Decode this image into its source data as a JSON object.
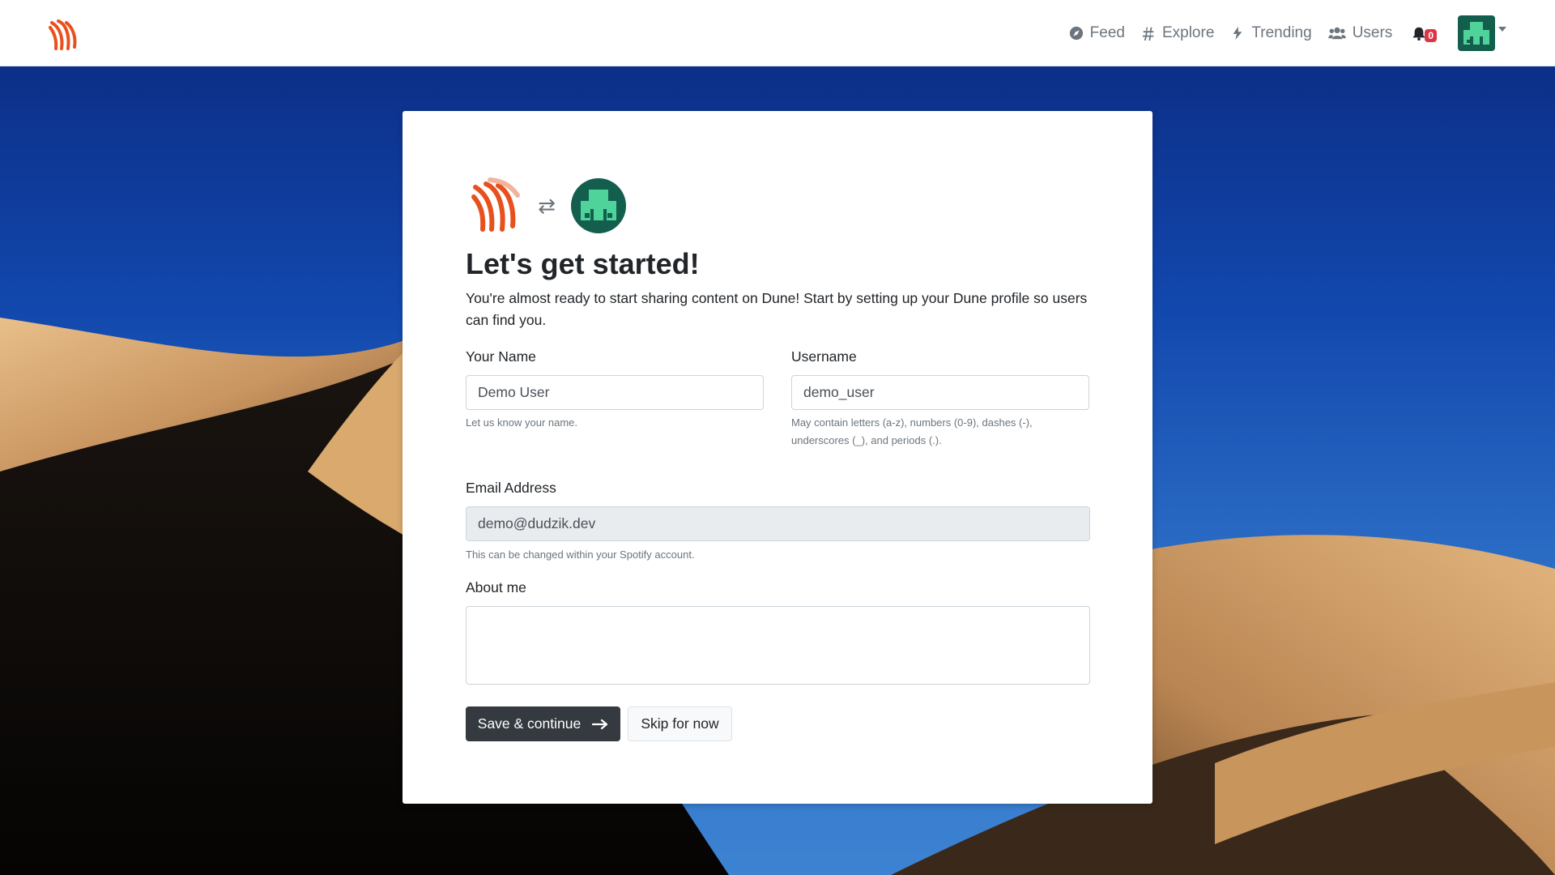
{
  "navbar": {
    "logo_icon": "dune-logo-icon",
    "links": [
      {
        "label": "Feed",
        "icon": "compass-icon"
      },
      {
        "label": "Explore",
        "icon": "hashtag-icon"
      },
      {
        "label": "Trending",
        "icon": "bolt-icon"
      },
      {
        "label": "Users",
        "icon": "users-icon"
      }
    ],
    "notifications_count": "0",
    "avatar_icon": "user-avatar-icon"
  },
  "card": {
    "swap_symbol": "⇄",
    "title": "Let's get started!",
    "lead": "You're almost ready to start sharing content on Dune! Start by setting up your Dune profile so users can find you.",
    "name": {
      "label": "Your Name",
      "value": "Demo User",
      "help": "Let us know your name."
    },
    "username": {
      "label": "Username",
      "value": "demo_user",
      "help": "May contain letters (a-z), numbers (0-9), dashes (-), underscores (_), and periods (.)."
    },
    "email": {
      "label": "Email Address",
      "value": "demo@dudzik.dev",
      "help": "This can be changed within your Spotify account."
    },
    "about": {
      "label": "About me",
      "value": ""
    },
    "save_label": "Save & continue",
    "skip_label": "Skip for now"
  },
  "colors": {
    "accent": "#343a40",
    "brand": "#e8501e",
    "avatar_bg": "#135e4d",
    "avatar_fg": "#4fd39a",
    "badge": "#dc3545"
  }
}
